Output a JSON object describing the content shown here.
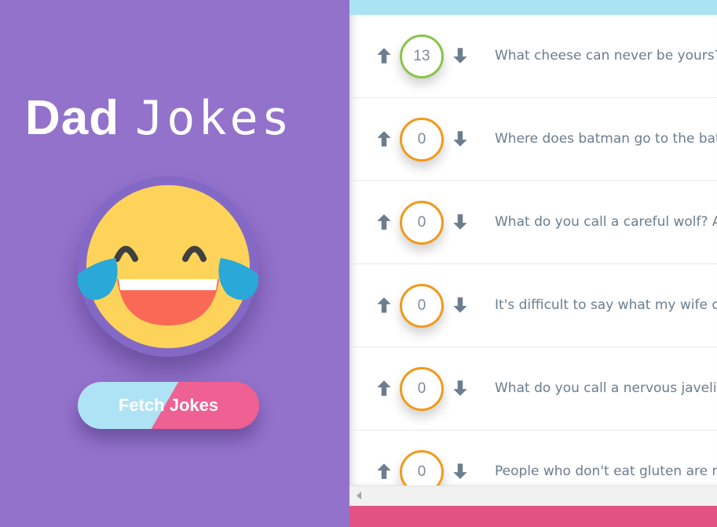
{
  "header": {
    "title_bold": "Dad",
    "title_light": "Jokes"
  },
  "emoji": {
    "icon": "laughing-tears-emoji"
  },
  "fetch_button": {
    "label_left": "Fetch",
    "label_right": "Jokes"
  },
  "colors": {
    "sidebar_bg": "#9372cc",
    "panel_top_accent": "#a9e3f4",
    "panel_bottom_accent": "#e25384",
    "score_green": "#8bc34a",
    "score_orange": "#f19a1a",
    "arrow_color": "#6b7d8e"
  },
  "jokes": [
    {
      "votes": "13",
      "rating": "green",
      "text": "What cheese can never be yours?"
    },
    {
      "votes": "0",
      "rating": "orange",
      "text": "Where does batman go to the bathroom?"
    },
    {
      "votes": "0",
      "rating": "orange",
      "text": "What do you call a careful wolf? Aware wolf."
    },
    {
      "votes": "0",
      "rating": "orange",
      "text": "It's difficult to say what my wife does."
    },
    {
      "votes": "0",
      "rating": "orange",
      "text": "What do you call a nervous javelin thrower?"
    },
    {
      "votes": "0",
      "rating": "orange",
      "text": "People who don't eat gluten are really going"
    }
  ]
}
